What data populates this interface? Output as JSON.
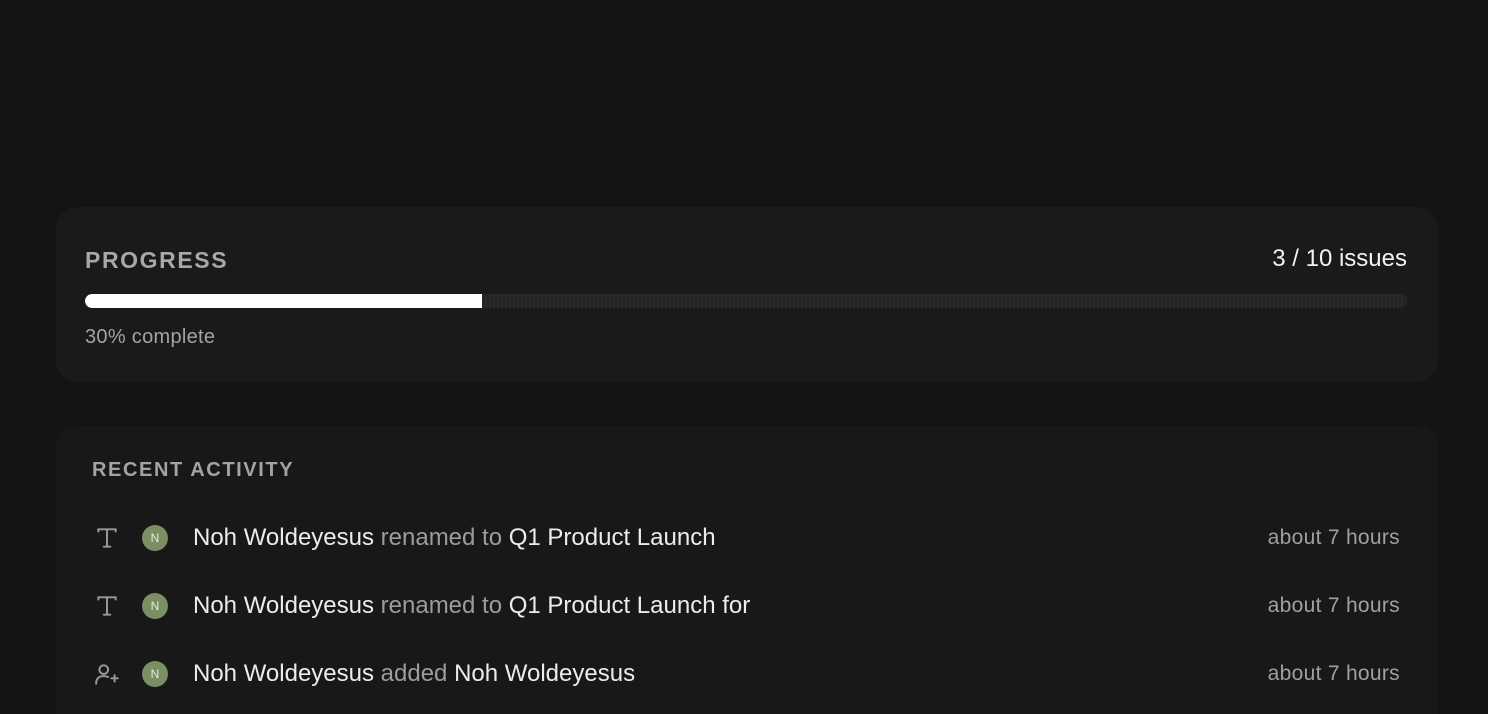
{
  "progress": {
    "title": "PROGRESS",
    "count_text": "3 / 10 issues",
    "completed": 3,
    "total": 10,
    "fraction": 0.3,
    "percent_text": "30% complete"
  },
  "activity": {
    "title": "RECENT ACTIVITY",
    "items": [
      {
        "icon": "text-type-icon",
        "avatar_initial": "N",
        "actor": "Noh Woldeyesus",
        "verb": "renamed to",
        "target": "Q1 Product Launch",
        "time": "about 7 hours"
      },
      {
        "icon": "text-type-icon",
        "avatar_initial": "N",
        "actor": "Noh Woldeyesus",
        "verb": "renamed to",
        "target": "Q1 Product Launch for",
        "time": "about 7 hours"
      },
      {
        "icon": "user-add-icon",
        "avatar_initial": "N",
        "actor": "Noh Woldeyesus",
        "verb": "added",
        "target": "Noh Woldeyesus",
        "time": "about 7 hours"
      }
    ]
  },
  "colors": {
    "background": "#141414",
    "card": "#1a1a1a",
    "bar_fill": "#ffffff",
    "avatar": "#7a8f62"
  }
}
